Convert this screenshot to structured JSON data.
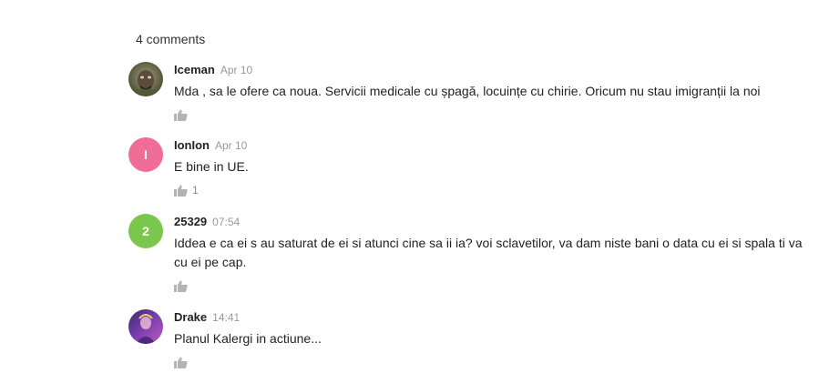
{
  "header": {
    "comments_count_label": "4 comments"
  },
  "colors": {
    "avatar_pink": "#f06d97",
    "avatar_green": "#7bc74d",
    "like_icon": "#b3b3b3"
  },
  "icons": {
    "like": "thumbs-up-icon"
  },
  "comments": [
    {
      "author": "Iceman",
      "time": "Apr 10",
      "text": "Mda , sa le ofere ca noua. Servicii medicale cu șpagă, locuințe cu chirie. Oricum nu stau imigranții la noi",
      "likes": "",
      "avatar": {
        "type": "photo"
      }
    },
    {
      "author": "IonIon",
      "time": "Apr 10",
      "text": "E bine in UE.",
      "likes": "1",
      "avatar": {
        "type": "letter",
        "letter": "I",
        "color": "#f06d97"
      }
    },
    {
      "author": "25329",
      "time": "07:54",
      "text": "Iddea e ca ei s au saturat de ei si atunci cine sa ii ia? voi sclavetilor, va dam niste bani o data cu ei si spala ti va cu ei pe cap.",
      "likes": "",
      "avatar": {
        "type": "letter",
        "letter": "2",
        "color": "#7bc74d"
      }
    },
    {
      "author": "Drake",
      "time": "14:41",
      "text": "Planul Kalergi in actiune...",
      "likes": "",
      "avatar": {
        "type": "photo"
      }
    }
  ]
}
